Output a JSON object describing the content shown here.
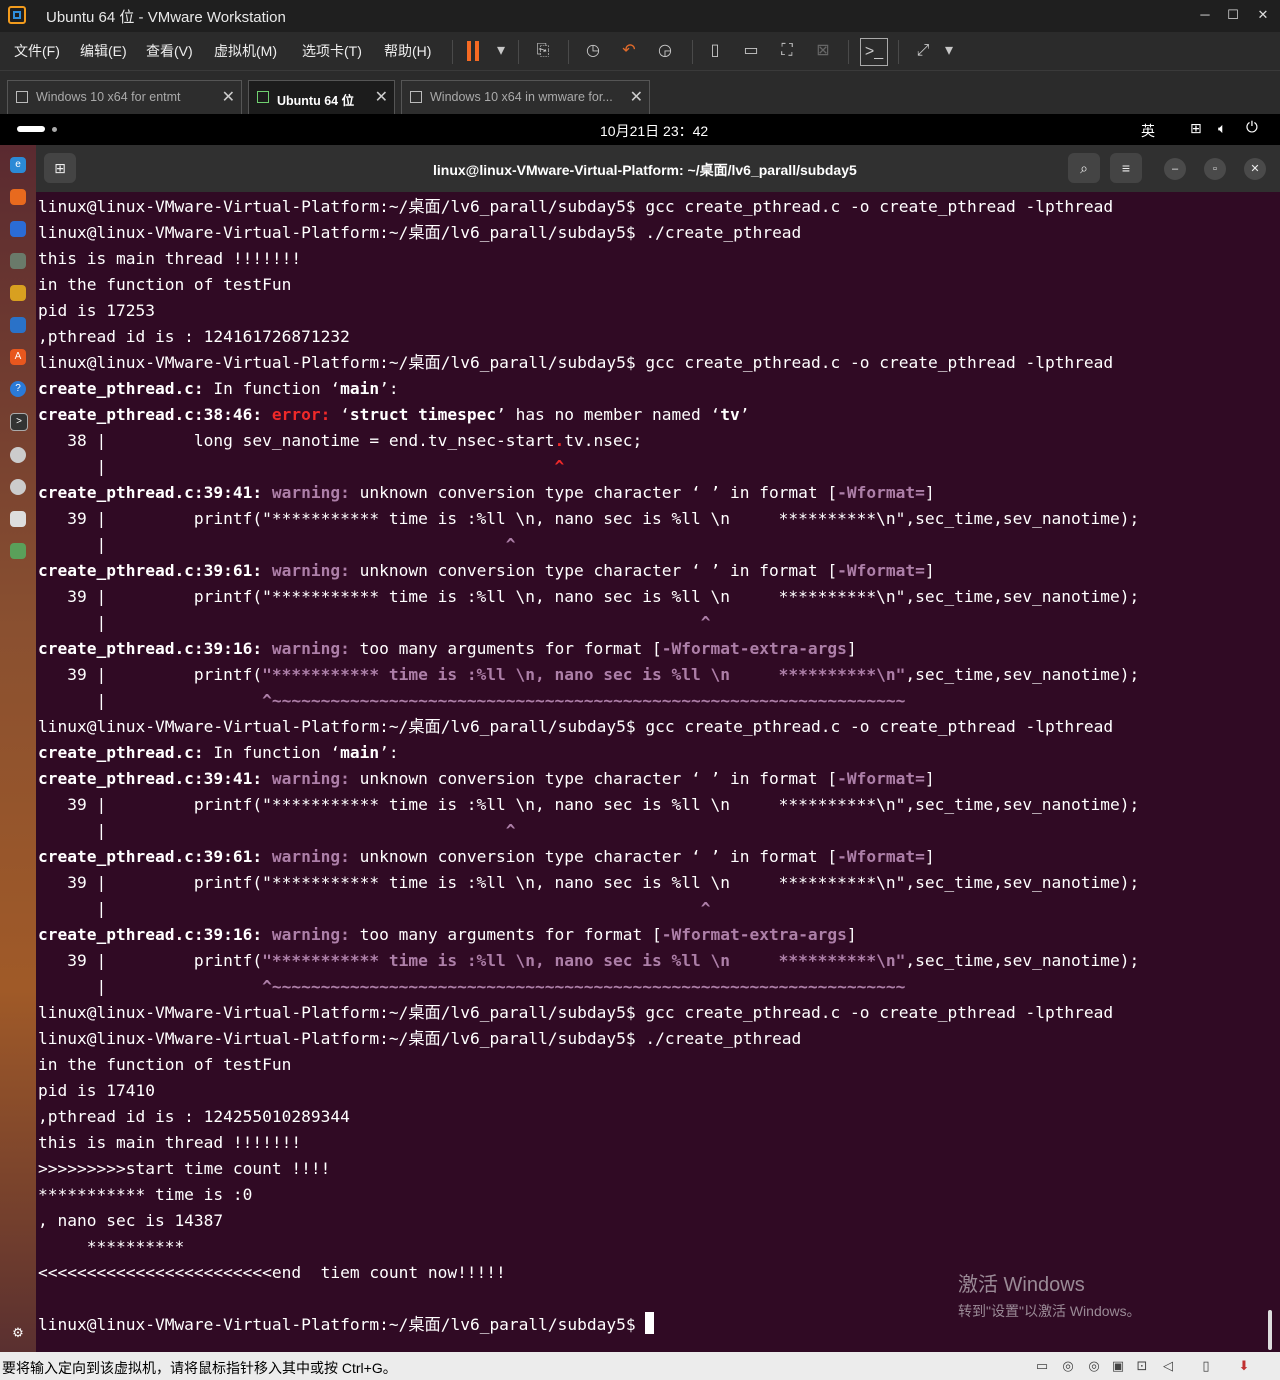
{
  "window": {
    "title": "Ubuntu 64 位 - VMware Workstation",
    "minimize": "─",
    "maximize": "☐",
    "close": "✕"
  },
  "menu": [
    "文件(F)",
    "编辑(E)",
    "查看(V)",
    "虚拟机(M)",
    "选项卡(T)",
    "帮助(H)"
  ],
  "toolbar": {
    "pause_color": "#f56a23",
    "icons": [
      "pause-icon",
      "dropdown-icon",
      "send-ctrl-alt-del-icon",
      "snapshot-icon",
      "revert-snapshot-icon",
      "snapshot-manager-icon",
      "library-icon",
      "thumbnail-icon",
      "fullscreen-icon",
      "unity-icon",
      "console-view-icon",
      "stretch-icon"
    ]
  },
  "tabs": [
    {
      "label": "Windows 10 x64 for entmt",
      "close": "✕"
    },
    {
      "label": "Ubuntu 64 位",
      "close": "✕"
    },
    {
      "label": "Windows 10 x64 in wmware for...",
      "close": "✕"
    }
  ],
  "gnome": {
    "clock": "10月21日  23：42",
    "input_method": "英"
  },
  "terminal": {
    "title": "linux@linux-VMware-Virtual-Platform: ~/桌面/lv6_parall/subday5",
    "background": "#300a24",
    "lines": [
      [
        {
          "t": "linux@linux-VMware-Virtual-Platform:~/桌面/lv6_parall/subday5$ gcc create_pthread.c -o create_pthread -lpthread"
        }
      ],
      [
        {
          "t": "linux@linux-VMware-Virtual-Platform:~/桌面/lv6_parall/subday5$ ./create_pthread"
        }
      ],
      [
        {
          "t": "this is main thread !!!!!!!"
        }
      ],
      [
        {
          "t": "in the function of testFun"
        }
      ],
      [
        {
          "t": "pid is 17253"
        }
      ],
      [
        {
          "t": ",pthread id is : 124161726871232"
        }
      ],
      [
        {
          "t": "linux@linux-VMware-Virtual-Platform:~/桌面/lv6_parall/subday5$ gcc create_pthread.c -o create_pthread -lpthread"
        }
      ],
      [
        {
          "t": "create_pthread.c:",
          "c": "b"
        },
        {
          "t": " In function ‘"
        },
        {
          "t": "main",
          "c": "b"
        },
        {
          "t": "’:"
        }
      ],
      [
        {
          "t": "create_pthread.c:38:46:",
          "c": "b"
        },
        {
          "t": " "
        },
        {
          "t": "error:",
          "c": "err"
        },
        {
          "t": " ‘"
        },
        {
          "t": "struct timespec",
          "c": "b"
        },
        {
          "t": "’ has no member named ‘"
        },
        {
          "t": "tv",
          "c": "b"
        },
        {
          "t": "’"
        }
      ],
      [
        {
          "t": "   38 |         long sev_nanotime = end.tv_nsec-start"
        },
        {
          "t": ".",
          "c": "err"
        },
        {
          "t": "tv.nsec;"
        }
      ],
      [
        {
          "t": "      |                                              "
        },
        {
          "t": "^",
          "c": "err"
        }
      ],
      [
        {
          "t": "create_pthread.c:39:41:",
          "c": "b"
        },
        {
          "t": " "
        },
        {
          "t": "warning:",
          "c": "warn"
        },
        {
          "t": " unknown conversion type character ‘ ’ in format ["
        },
        {
          "t": "-Wformat=",
          "c": "magb"
        },
        {
          "t": "]"
        }
      ],
      [
        {
          "t": "   39 |         printf(\"*********** time is :%ll"
        },
        {
          "t": " ",
          "c": "mag"
        },
        {
          "t": "\\n, nano sec is %ll \\n     **********\\n\",sec_time,sev_nanotime);"
        }
      ],
      [
        {
          "t": "      |                                         "
        },
        {
          "t": "^",
          "c": "magb"
        }
      ],
      [
        {
          "t": "create_pthread.c:39:61:",
          "c": "b"
        },
        {
          "t": " "
        },
        {
          "t": "warning:",
          "c": "warn"
        },
        {
          "t": " unknown conversion type character ‘ ’ in format ["
        },
        {
          "t": "-Wformat=",
          "c": "magb"
        },
        {
          "t": "]"
        }
      ],
      [
        {
          "t": "   39 |         printf(\"*********** time is :%ll \\n, nano sec is %ll \\n     **********\\n\",sec_time,sev_nanotime);"
        }
      ],
      [
        {
          "t": "      |                                                             "
        },
        {
          "t": "^",
          "c": "magb"
        }
      ],
      [
        {
          "t": "create_pthread.c:39:16:",
          "c": "b"
        },
        {
          "t": " "
        },
        {
          "t": "warning:",
          "c": "warn"
        },
        {
          "t": " too many arguments for format ["
        },
        {
          "t": "-Wformat-extra-args",
          "c": "magb"
        },
        {
          "t": "]"
        }
      ],
      [
        {
          "t": "   39 |         printf("
        },
        {
          "t": "\"*********** time is :%ll \\n, nano sec is %ll \\n     **********\\n\"",
          "c": "magb"
        },
        {
          "t": ",sec_time,sev_nanotime);"
        }
      ],
      [
        {
          "t": "      |                "
        },
        {
          "t": "^~~~~~~~~~~~~~~~~~~~~~~~~~~~~~~~~~~~~~~~~~~~~~~~~~~~~~~~~~~~~~~~~~",
          "c": "magb"
        }
      ],
      [
        {
          "t": "linux@linux-VMware-Virtual-Platform:~/桌面/lv6_parall/subday5$ gcc create_pthread.c -o create_pthread -lpthread"
        }
      ],
      [
        {
          "t": "create_pthread.c:",
          "c": "b"
        },
        {
          "t": " In function ‘"
        },
        {
          "t": "main",
          "c": "b"
        },
        {
          "t": "’:"
        }
      ],
      [
        {
          "t": "create_pthread.c:39:41:",
          "c": "b"
        },
        {
          "t": " "
        },
        {
          "t": "warning:",
          "c": "warn"
        },
        {
          "t": " unknown conversion type character ‘ ’ in format ["
        },
        {
          "t": "-Wformat=",
          "c": "magb"
        },
        {
          "t": "]"
        }
      ],
      [
        {
          "t": "   39 |         printf(\"*********** time is :%ll \\n, nano sec is %ll \\n     **********\\n\",sec_time,sev_nanotime);"
        }
      ],
      [
        {
          "t": "      |                                         "
        },
        {
          "t": "^",
          "c": "magb"
        }
      ],
      [
        {
          "t": "create_pthread.c:39:61:",
          "c": "b"
        },
        {
          "t": " "
        },
        {
          "t": "warning:",
          "c": "warn"
        },
        {
          "t": " unknown conversion type character ‘ ’ in format ["
        },
        {
          "t": "-Wformat=",
          "c": "magb"
        },
        {
          "t": "]"
        }
      ],
      [
        {
          "t": "   39 |         printf(\"*********** time is :%ll \\n, nano sec is %ll \\n     **********\\n\",sec_time,sev_nanotime);"
        }
      ],
      [
        {
          "t": "      |                                                             "
        },
        {
          "t": "^",
          "c": "magb"
        }
      ],
      [
        {
          "t": "create_pthread.c:39:16:",
          "c": "b"
        },
        {
          "t": " "
        },
        {
          "t": "warning:",
          "c": "warn"
        },
        {
          "t": " too many arguments for format ["
        },
        {
          "t": "-Wformat-extra-args",
          "c": "magb"
        },
        {
          "t": "]"
        }
      ],
      [
        {
          "t": "   39 |         printf("
        },
        {
          "t": "\"*********** time is :%ll \\n, nano sec is %ll \\n     **********\\n\"",
          "c": "magb"
        },
        {
          "t": ",sec_time,sev_nanotime);"
        }
      ],
      [
        {
          "t": "      |                "
        },
        {
          "t": "^~~~~~~~~~~~~~~~~~~~~~~~~~~~~~~~~~~~~~~~~~~~~~~~~~~~~~~~~~~~~~~~~~",
          "c": "magb"
        }
      ],
      [
        {
          "t": "linux@linux-VMware-Virtual-Platform:~/桌面/lv6_parall/subday5$ gcc create_pthread.c -o create_pthread -lpthread"
        }
      ],
      [
        {
          "t": "linux@linux-VMware-Virtual-Platform:~/桌面/lv6_parall/subday5$ ./create_pthread"
        }
      ],
      [
        {
          "t": "in the function of testFun"
        }
      ],
      [
        {
          "t": "pid is 17410"
        }
      ],
      [
        {
          "t": ",pthread id is : 124255010289344"
        }
      ],
      [
        {
          "t": "this is main thread !!!!!!!"
        }
      ],
      [
        {
          "t": ">>>>>>>>>start time count !!!!"
        }
      ],
      [
        {
          "t": "*********** time is :0"
        }
      ],
      [
        {
          "t": ", nano sec is 14387"
        }
      ],
      [
        {
          "t": "     **********"
        }
      ],
      [
        {
          "t": "<<<<<<<<<<<<<<<<<<<<<<<<end  tiem count now!!!!!"
        }
      ],
      [
        {
          "t": ""
        }
      ],
      [
        {
          "t": "linux@linux-VMware-Virtual-Platform:~/桌面/lv6_parall/subday5$ "
        },
        {
          "t": "",
          "c": "cursor"
        }
      ]
    ]
  },
  "activation": {
    "title": "激活 Windows",
    "subtitle": "转到\"设置\"以激活 Windows。"
  },
  "statusbar": {
    "message": "要将输入定向到该虚拟机，请将鼠标指针移入其中或按 Ctrl+G。"
  }
}
